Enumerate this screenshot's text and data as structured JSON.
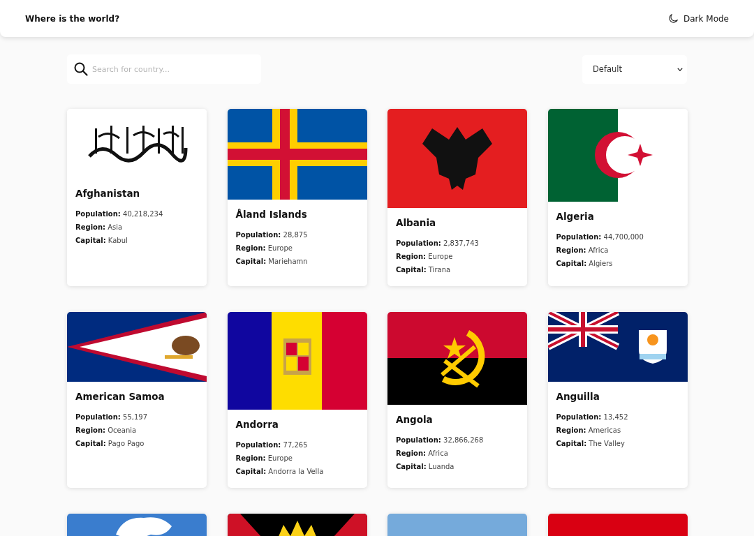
{
  "header": {
    "title": "Where is the world?",
    "theme_toggle": "Dark Mode"
  },
  "search": {
    "placeholder": "Search for country..."
  },
  "region_filter": {
    "value": "Default"
  },
  "countries": [
    {
      "name": "Afghanistan",
      "facts": [
        "**Population:** 40,218,234",
        "**Region:** Asia",
        "**Capital:** Kabul"
      ]
    },
    {
      "name": "Åland Islands",
      "facts": [
        "**Population:** 28,875",
        "**Region:** Europe",
        "**Capital:** Mariehamn"
      ]
    },
    {
      "name": "Albania",
      "facts": [
        "**Population:** 2,837,743",
        "**Region:** Europe",
        "**Capital:** Tirana"
      ]
    },
    {
      "name": "Algeria",
      "facts": [
        "**Population:** 44,700,000",
        "**Region:** Africa",
        "**Capital:** Algiers"
      ]
    },
    {
      "name": "American Samoa",
      "facts": [
        "**Population:** 55,197",
        "**Region:** Oceania",
        "**Capital:** Pago Pago"
      ]
    },
    {
      "name": "Andorra",
      "facts": [
        "**Population:** 77,265",
        "**Region:** Europe",
        "**Capital:** Andorra la Vella"
      ]
    },
    {
      "name": "Angola",
      "facts": [
        "**Population:** 32,866,268",
        "**Region:** Africa",
        "**Capital:** Luanda"
      ]
    },
    {
      "name": "Anguilla",
      "facts": [
        "**Population:** 13,452",
        "**Region:** Americas",
        "**Capital:** The Valley"
      ]
    }
  ]
}
